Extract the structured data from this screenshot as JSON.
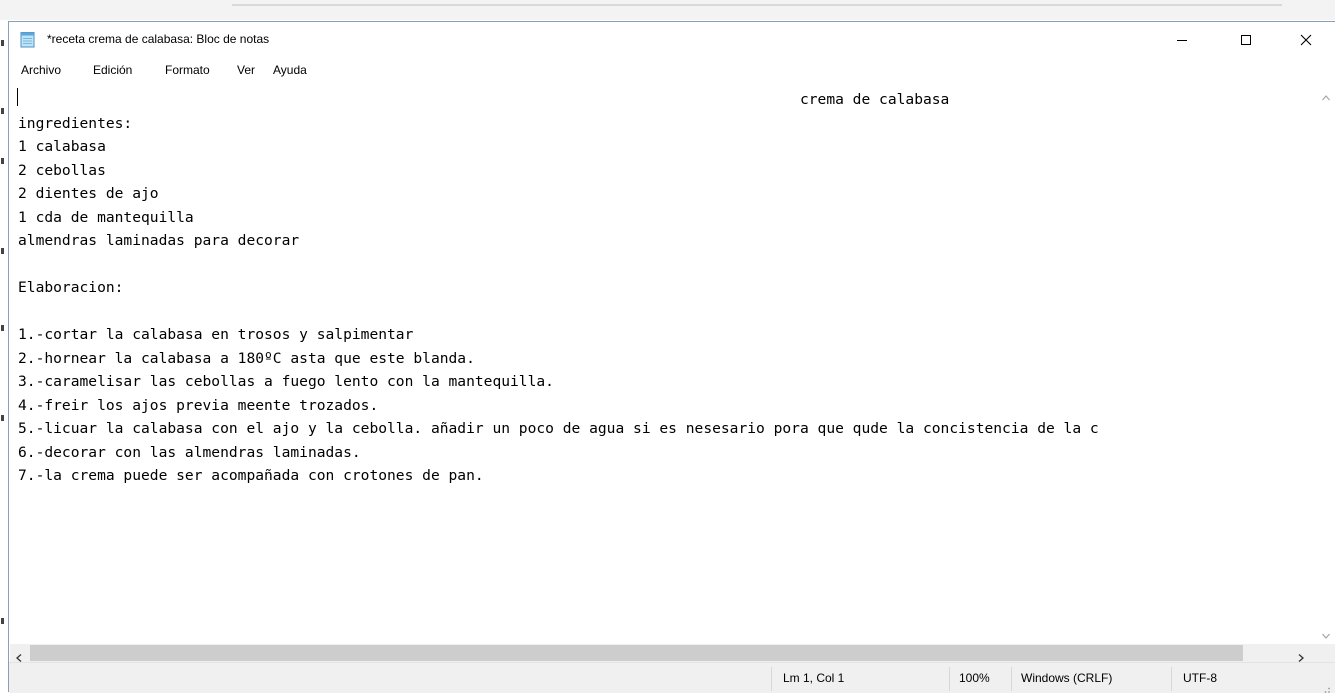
{
  "window": {
    "title": "*receta crema de calabasa: Bloc de notas"
  },
  "menu": {
    "items": [
      "Archivo",
      "Edición",
      "Formato",
      "Ver",
      "Ayuda"
    ]
  },
  "editor": {
    "content": "                                                                                         crema de calabasa\ningredientes:\n1 calabasa\n2 cebollas\n2 dientes de ajo\n1 cda de mantequilla\nalmendras laminadas para decorar\n\nElaboracion:\n\n1.-cortar la calabasa en trosos y salpimentar\n2.-hornear la calabasa a 180ºC asta que este blanda.\n3.-caramelisar las cebollas a fuego lento con la mantequilla.\n4.-freir los ajos previa meente trozados.\n5.-licuar la calabasa con el ajo y la cebolla. añadir un poco de agua si es nesesario pora que qude la concistencia de la c\n6.-decorar con las almendras laminadas.\n7.-la crema puede ser acompañada con crotones de pan."
  },
  "status": {
    "position": "Lm 1, Col 1",
    "zoom": "100%",
    "line_ending": "Windows (CRLF)",
    "encoding": "UTF-8"
  },
  "icons": {
    "app": "notepad-icon",
    "minimize": "minimize-icon",
    "maximize": "maximize-icon",
    "close": "close-icon"
  },
  "colors": {
    "scroll_thumb": "#cdcdcd",
    "statusbar_bg": "#f0f0f0",
    "window_border": "#8aa0b8"
  }
}
